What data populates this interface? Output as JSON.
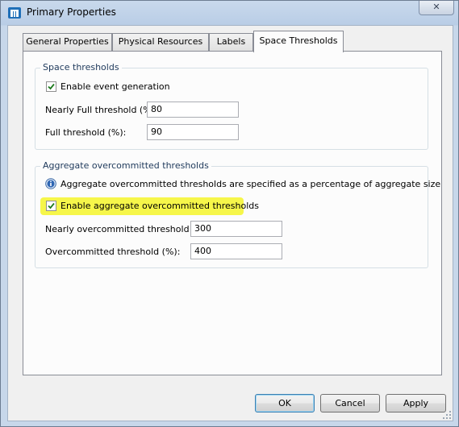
{
  "window": {
    "title": "Primary Properties",
    "close_glyph": "✕"
  },
  "tabs": [
    {
      "label": "General Properties",
      "active": false
    },
    {
      "label": "Physical Resources",
      "active": false
    },
    {
      "label": "Labels",
      "active": false
    },
    {
      "label": "Space Thresholds",
      "active": true
    }
  ],
  "space_thresholds": {
    "title": "Space thresholds",
    "enable_event_generation": {
      "label": "Enable event generation",
      "checked": true
    },
    "nearly_full": {
      "label": "Nearly Full threshold (%):",
      "value": "80"
    },
    "full": {
      "label": "Full threshold (%):",
      "value": "90"
    }
  },
  "aggregate": {
    "title": "Aggregate overcommitted thresholds",
    "info_text": "Aggregate overcommitted thresholds are specified as a percentage of aggregate size",
    "enable_thresholds": {
      "label": "Enable aggregate overcommitted thresholds",
      "checked": true,
      "highlighted": true
    },
    "nearly_overcommitted": {
      "label": "Nearly overcommitted threshold (%):",
      "value": "300"
    },
    "overcommitted": {
      "label": "Overcommitted threshold (%):",
      "value": "400"
    }
  },
  "buttons": {
    "ok": "OK",
    "cancel": "Cancel",
    "apply": "Apply"
  },
  "colors": {
    "highlight": "#f4f42a",
    "group_title": "#1e395b",
    "default_button_border": "#3c7fb1"
  }
}
